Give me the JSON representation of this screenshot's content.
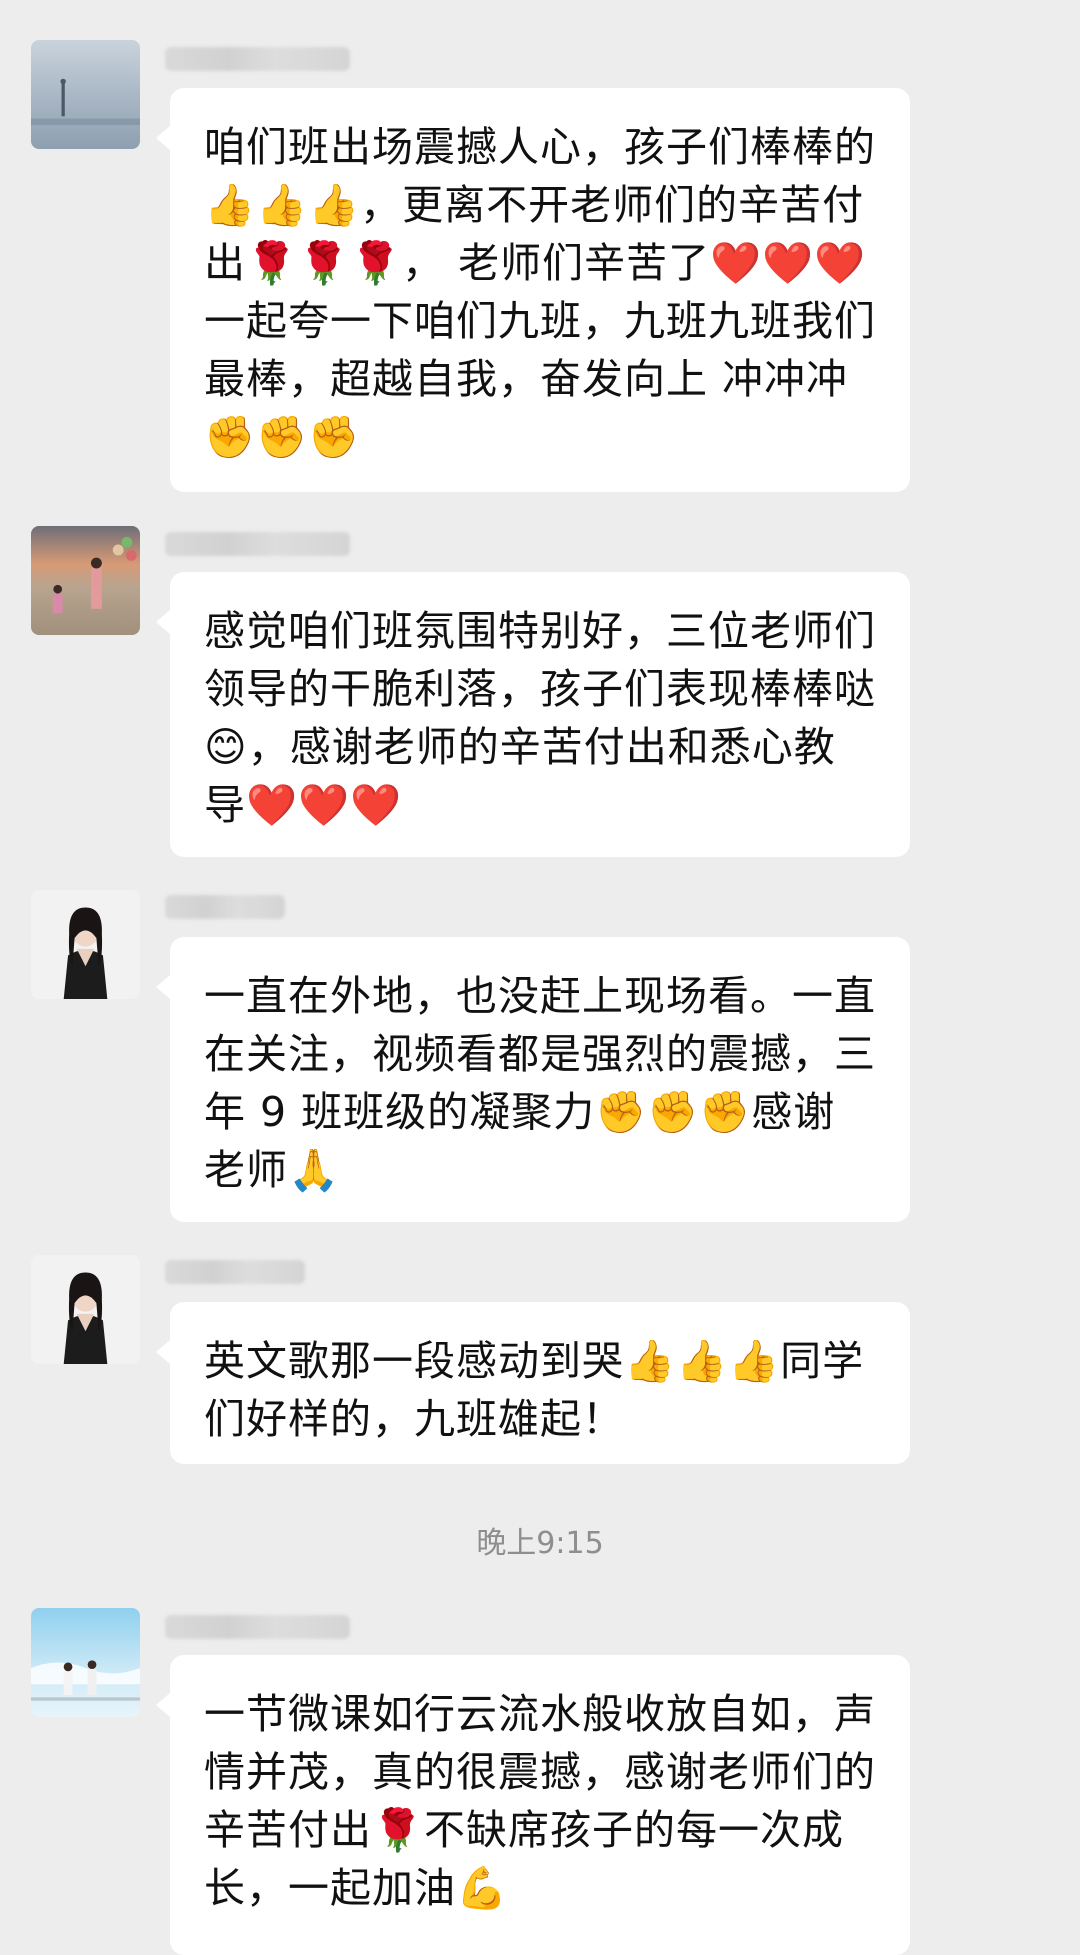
{
  "chat": {
    "messages": [
      {
        "avatar_icon": "lake-scene-avatar-icon",
        "text": "咱们班出场震撼人心，孩子们棒棒的👍👍👍，更离不开老师们的辛苦付出🌹🌹🌹， 老师们辛苦了❤️❤️❤️一起夸一下咱们九班，九班九班我们最棒，超越自我，奋发向上 冲冲冲✊✊✊"
      },
      {
        "avatar_icon": "beach-family-avatar-icon",
        "text": "感觉咱们班氛围特别好，三位老师们领导的干脆利落，孩子们表现棒棒哒😊，感谢老师的辛苦付出和悉心教导❤️❤️❤️"
      },
      {
        "avatar_icon": "woman-portrait-avatar-icon",
        "text": "一直在外地，也没赶上现场看。一直在关注，视频看都是强烈的震撼，三年 9 班班级的凝聚力✊✊✊感谢老师🙏"
      },
      {
        "avatar_icon": "woman-portrait-avatar-icon",
        "text": "英文歌那一段感动到哭👍👍👍同学们好样的，九班雄起！"
      },
      {
        "avatar_icon": "sea-kids-avatar-icon",
        "text": "一节微课如行云流水般收放自如，声情并茂，真的很震撼，感谢老师们的辛苦付出🌹不缺席孩子的每一次成长，一起加油💪"
      }
    ],
    "timestamp": "晚上9:15"
  },
  "colors": {
    "background": "#ededed",
    "bubble": "#ffffff",
    "text": "#111111",
    "timestamp": "#8e8e8e"
  }
}
